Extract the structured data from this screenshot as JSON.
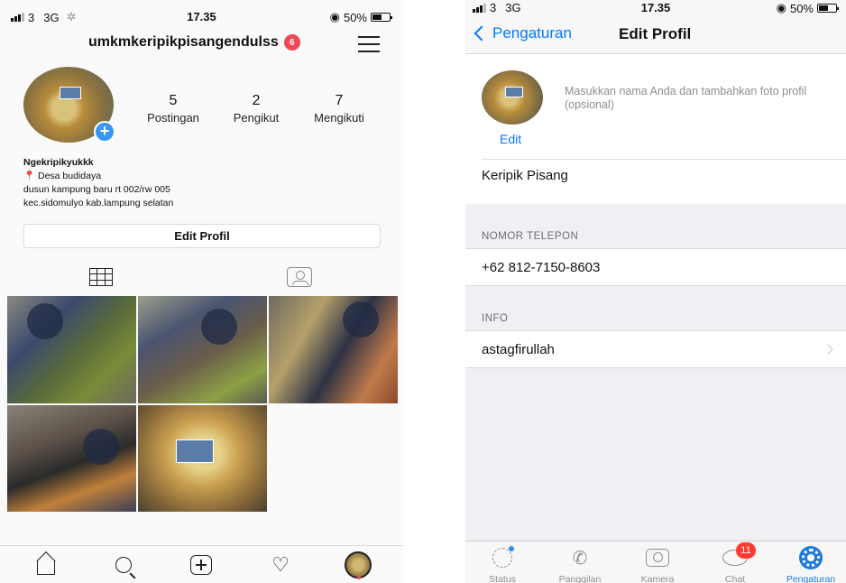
{
  "left": {
    "status": {
      "carrier": "3",
      "network": "3G",
      "time": "17.35",
      "battery": "50%"
    },
    "header": {
      "username": "umkmkeripikpisangendulss",
      "notification_count": "6"
    },
    "stats": [
      {
        "value": "5",
        "label": "Postingan"
      },
      {
        "value": "2",
        "label": "Pengikut"
      },
      {
        "value": "7",
        "label": "Mengikuti"
      }
    ],
    "bio": {
      "name": "Ngekripikyukkk",
      "location": "Desa budidaya",
      "line1": "dusun kampung baru rt 002/rw 005",
      "line2": "kec.sidomulyo kab.lampung selatan"
    },
    "edit_profile_label": "Edit Profil",
    "nav_icons": [
      "home-icon",
      "search-icon",
      "add-post-icon",
      "heart-icon",
      "profile-avatar"
    ]
  },
  "right": {
    "status": {
      "carrier": "3",
      "network": "3G",
      "time": "17.35",
      "battery": "50%"
    },
    "header": {
      "back_label": "Pengaturan",
      "title": "Edit Profil"
    },
    "profile": {
      "edit_label": "Edit",
      "hint": "Masukkan nama Anda dan tambahkan foto profil (opsional)",
      "name": "Keripik Pisang"
    },
    "phone_section": {
      "label": "NOMOR TELEPON",
      "value": "+62 812-7150-8603"
    },
    "info_section": {
      "label": "INFO",
      "value": "astagfirullah"
    },
    "tabs": [
      {
        "label": "Status"
      },
      {
        "label": "Panggilan"
      },
      {
        "label": "Kamera"
      },
      {
        "label": "Chat",
        "badge": "11"
      },
      {
        "label": "Pengaturan"
      }
    ],
    "accent_color": "#007aff"
  }
}
